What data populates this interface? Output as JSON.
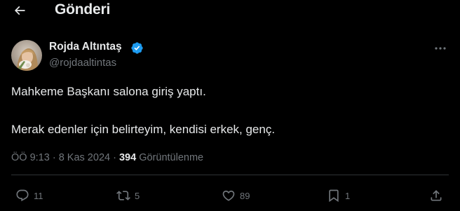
{
  "header": {
    "title": "Gönderi",
    "back_icon": "arrow-left-icon"
  },
  "author": {
    "name": "Rojda Altıntaş",
    "handle": "@rojdaaltintas",
    "verified": true,
    "badge_color": "#1d9bf0"
  },
  "tweet": {
    "lines": [
      "Mahkeme Başkanı salona giriş yaptı.",
      "Merak edenler için belirteyim, kendisi erkek, genç."
    ]
  },
  "meta": {
    "time": "ÖÖ 9:13",
    "separator1": " · ",
    "date": "8 Kas 2024",
    "separator2": " · ",
    "views_count": "394",
    "views_label": "Görüntülenme"
  },
  "actions": {
    "replies": "11",
    "reposts": "5",
    "likes": "89",
    "bookmarks": "1"
  },
  "colors": {
    "background": "#000000",
    "text_primary": "#e7e9ea",
    "text_secondary": "#71767b",
    "divider": "#2f3336"
  }
}
